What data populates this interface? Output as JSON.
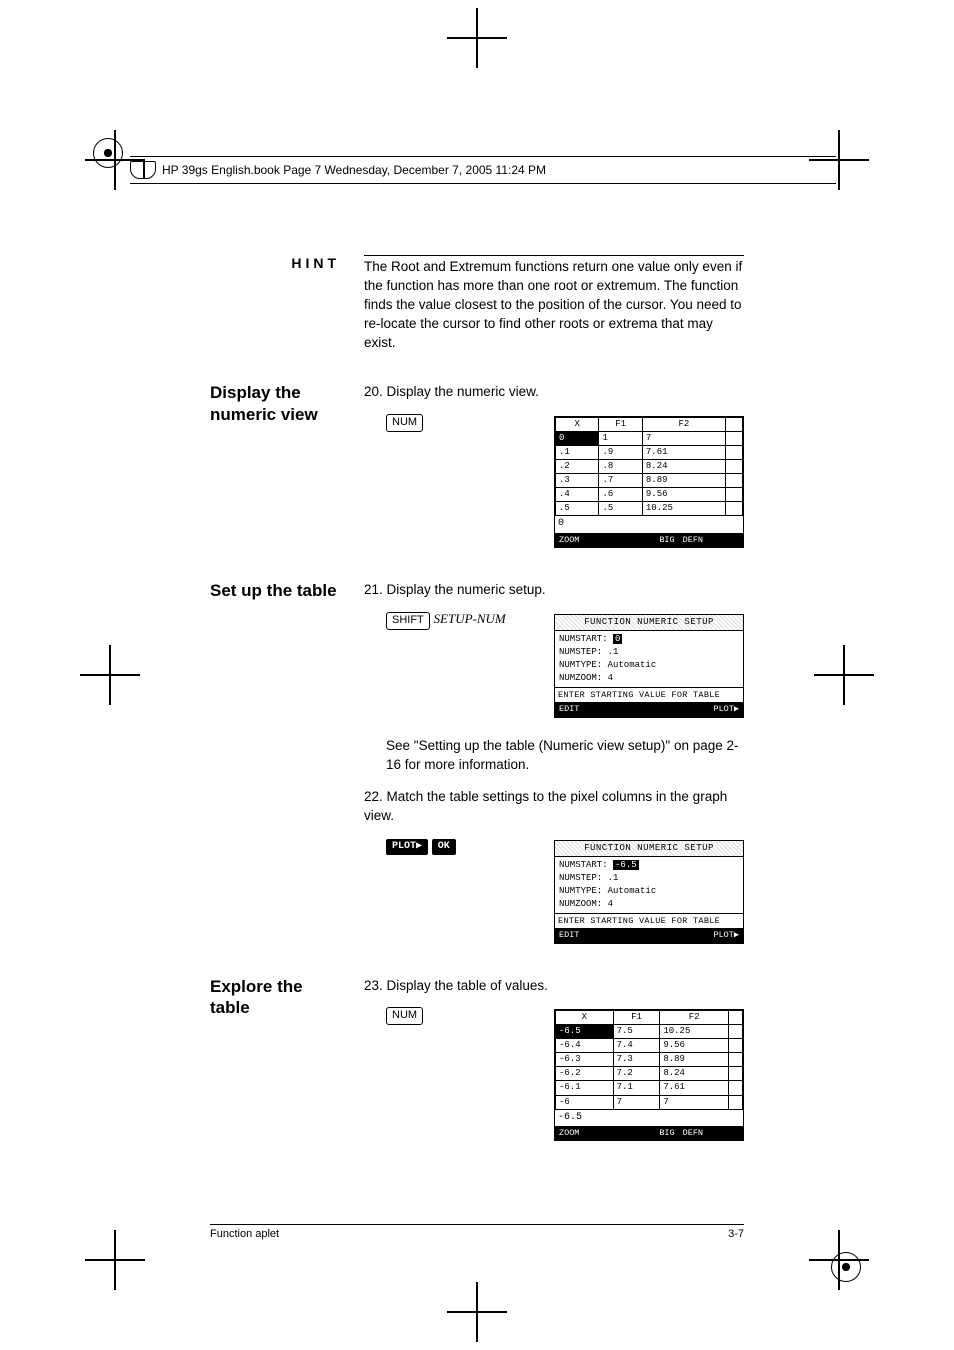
{
  "header_line": "HP 39gs English.book  Page 7  Wednesday, December 7, 2005  11:24 PM",
  "hint": {
    "label": "HINT",
    "text": "The Root and Extremum functions return one value only even if the function has more than one root or extremum. The function finds the value closest to the position of the cursor. You need to re-locate the cursor to find other roots or extrema that may exist."
  },
  "display_numeric": {
    "title": "Display the numeric view",
    "step": "20. Display the numeric view.",
    "key": "NUM",
    "screen": {
      "cols": [
        "X",
        "F1",
        "F2",
        ""
      ],
      "rows": [
        [
          "0",
          "1",
          "7",
          ""
        ],
        [
          ".1",
          ".9",
          "7.61",
          ""
        ],
        [
          ".2",
          ".8",
          "8.24",
          ""
        ],
        [
          ".3",
          ".7",
          "8.89",
          ""
        ],
        [
          ".4",
          ".6",
          "9.56",
          ""
        ],
        [
          ".5",
          ".5",
          "10.25",
          ""
        ]
      ],
      "status": "0",
      "menu": [
        "ZOOM",
        "",
        "",
        "BIG",
        "DEFN",
        ""
      ]
    }
  },
  "setup_table": {
    "title": "Set up the table",
    "step21": "21. Display the numeric setup.",
    "shift": "SHIFT",
    "shift_label": "SETUP-NUM",
    "screen1": {
      "title": "FUNCTION NUMERIC SETUP",
      "rows": [
        [
          "NUMSTART:",
          "0",
          true
        ],
        [
          "NUMSTEP:",
          ".1",
          false
        ],
        [
          "NUMTYPE:",
          "Automatic",
          false
        ],
        [
          "NUMZOOM:",
          "4",
          false
        ]
      ],
      "msg": "ENTER STARTING VALUE FOR TABLE",
      "menu": [
        "EDIT",
        "",
        "",
        "",
        "",
        "PLOT▶"
      ]
    },
    "para": "See \"Setting up the table (Numeric view setup)\" on page 2-16 for more information.",
    "step22": "22. Match the table settings to the pixel columns in the graph view.",
    "softkeys": [
      "PLOT▶",
      "OK"
    ],
    "screen2": {
      "title": "FUNCTION NUMERIC SETUP",
      "rows": [
        [
          "NUMSTART:",
          "-6.5",
          true
        ],
        [
          "NUMSTEP:",
          ".1",
          false
        ],
        [
          "NUMTYPE:",
          "Automatic",
          false
        ],
        [
          "NUMZOOM:",
          "4",
          false
        ]
      ],
      "msg": "ENTER STARTING VALUE FOR TABLE",
      "menu": [
        "EDIT",
        "",
        "",
        "",
        "",
        "PLOT▶"
      ]
    }
  },
  "explore": {
    "title": "Explore the table",
    "step": "23. Display the table of values.",
    "key": "NUM",
    "screen": {
      "cols": [
        "X",
        "F1",
        "F2",
        ""
      ],
      "rows": [
        [
          "-6.5",
          "7.5",
          "10.25",
          ""
        ],
        [
          "-6.4",
          "7.4",
          "9.56",
          ""
        ],
        [
          "-6.3",
          "7.3",
          "8.89",
          ""
        ],
        [
          "-6.2",
          "7.2",
          "8.24",
          ""
        ],
        [
          "-6.1",
          "7.1",
          "7.61",
          ""
        ],
        [
          "-6",
          "7",
          "7",
          ""
        ]
      ],
      "status": "-6.5",
      "menu": [
        "ZOOM",
        "",
        "",
        "BIG",
        "DEFN",
        ""
      ]
    }
  },
  "footer": {
    "left": "Function aplet",
    "right": "3-7"
  }
}
